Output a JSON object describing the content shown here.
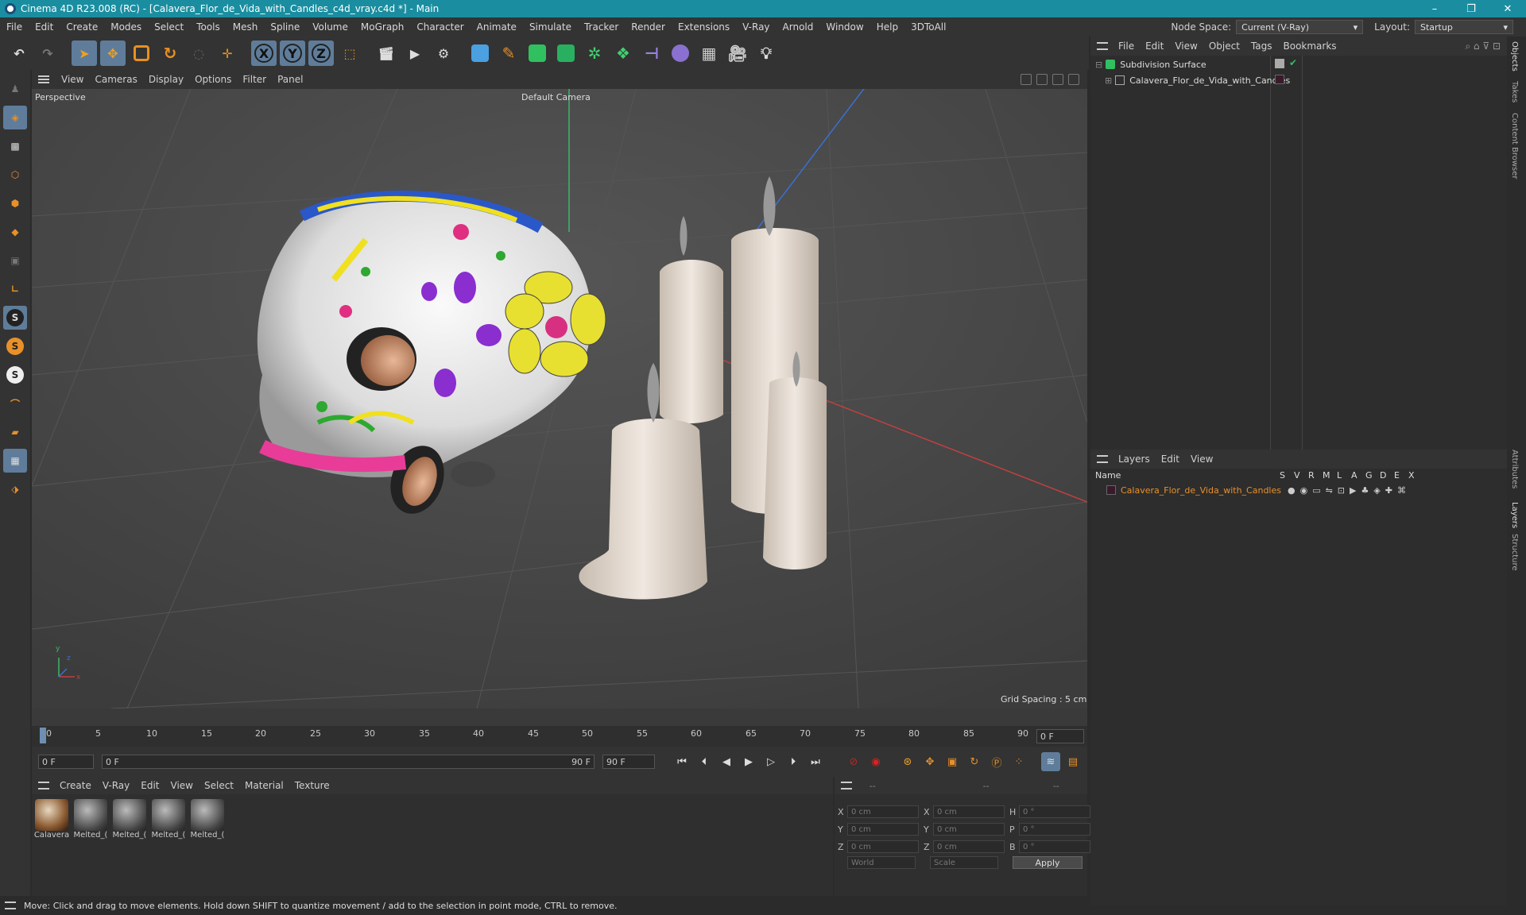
{
  "window": {
    "title": "Cinema 4D R23.008 (RC) - [Calavera_Flor_de_Vida_with_Candles_c4d_vray.c4d *] - Main",
    "minimize": "–",
    "restore": "❐",
    "close": "✕"
  },
  "menubar": {
    "items": [
      "File",
      "Edit",
      "Create",
      "Modes",
      "Select",
      "Tools",
      "Mesh",
      "Spline",
      "Volume",
      "MoGraph",
      "Character",
      "Animate",
      "Simulate",
      "Tracker",
      "Render",
      "Extensions",
      "V-Ray",
      "Arnold",
      "Window",
      "Help",
      "3DToAll"
    ],
    "node_space_label": "Node Space:",
    "node_space_value": "Current (V-Ray)",
    "layout_label": "Layout:",
    "layout_value": "Startup"
  },
  "viewport": {
    "menu": [
      "View",
      "Cameras",
      "Display",
      "Options",
      "Filter",
      "Panel"
    ],
    "label_perspective": "Perspective",
    "label_camera": "Default Camera",
    "grid_spacing": "Grid Spacing : 5 cm",
    "axis_y": "y",
    "axis_z": "z",
    "axis_x": "x"
  },
  "timeline": {
    "ticks": [
      "0",
      "5",
      "10",
      "15",
      "20",
      "25",
      "30",
      "35",
      "40",
      "45",
      "50",
      "55",
      "60",
      "65",
      "70",
      "75",
      "80",
      "85",
      "90"
    ],
    "current_frame": "0 F"
  },
  "playbar": {
    "start": "0 F",
    "range_start": "0 F",
    "range_end": "90 F",
    "end": "90 F"
  },
  "material_manager": {
    "menu": [
      "Create",
      "V-Ray",
      "Edit",
      "View",
      "Select",
      "Material",
      "Texture"
    ],
    "materials": [
      "Calavera",
      "Melted_(",
      "Melted_(",
      "Melted_(",
      "Melted_("
    ]
  },
  "coordinates": {
    "headers": [
      "--",
      "--",
      "--"
    ],
    "rows": [
      {
        "a": "X",
        "v1": "0 cm",
        "b": "X",
        "v2": "0 cm",
        "c": "H",
        "v3": "0 °"
      },
      {
        "a": "Y",
        "v1": "0 cm",
        "b": "Y",
        "v2": "0 cm",
        "c": "P",
        "v3": "0 °"
      },
      {
        "a": "Z",
        "v1": "0 cm",
        "b": "Z",
        "v2": "0 cm",
        "c": "B",
        "v3": "0 °"
      }
    ],
    "world": "World",
    "scale": "Scale",
    "apply": "Apply"
  },
  "object_manager": {
    "menu": [
      "File",
      "Edit",
      "View",
      "Object",
      "Tags",
      "Bookmarks"
    ],
    "objects": [
      "Subdivision Surface",
      "Calavera_Flor_de_Vida_with_Candles"
    ]
  },
  "layer_manager": {
    "menu": [
      "Layers",
      "Edit",
      "View"
    ],
    "name_col": "Name",
    "flag_cols": [
      "S",
      "V",
      "R",
      "M",
      "L",
      "A",
      "G",
      "D",
      "E",
      "X"
    ],
    "layers": [
      "Calavera_Flor_de_Vida_with_Candles"
    ]
  },
  "sidetabs": [
    "Objects",
    "Takes",
    "Content Browser",
    "Attributes",
    "Layers",
    "Structure"
  ],
  "status": "Move: Click and drag to move elements. Hold down SHIFT to quantize movement / add to the selection in point mode, CTRL to remove.",
  "colors": {
    "accent": "#1a8ea0",
    "selected": "#5f7d9a",
    "layer_color": "#e8902a"
  }
}
